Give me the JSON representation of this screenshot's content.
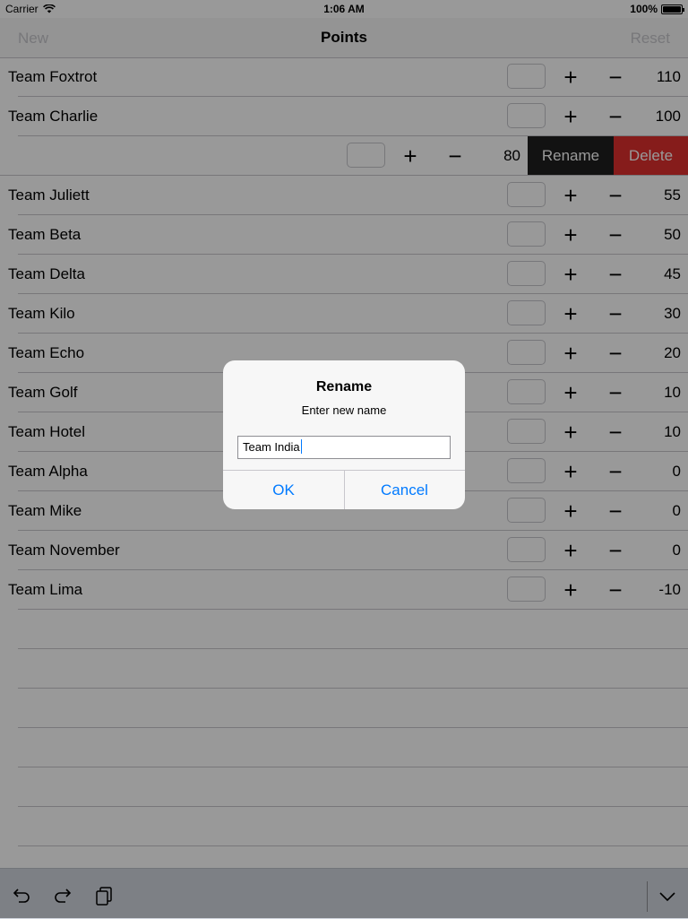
{
  "status_bar": {
    "carrier": "Carrier",
    "time": "1:06 AM",
    "battery": "100%"
  },
  "nav": {
    "left_button": "New",
    "title": "Points",
    "right_button": "Reset"
  },
  "teams": [
    {
      "name": "Team Foxtrot",
      "score": "110"
    },
    {
      "name": "Team Charlie",
      "score": "100"
    },
    {
      "name": "",
      "score": "80"
    },
    {
      "name": "Team Juliett",
      "score": "55"
    },
    {
      "name": "Team Beta",
      "score": "50"
    },
    {
      "name": "Team Delta",
      "score": "45"
    },
    {
      "name": "Team Kilo",
      "score": "30"
    },
    {
      "name": "Team Echo",
      "score": "20"
    },
    {
      "name": "Team Golf",
      "score": "10"
    },
    {
      "name": "Team Hotel",
      "score": "10"
    },
    {
      "name": "Team Alpha",
      "score": "0"
    },
    {
      "name": "Team Mike",
      "score": "0"
    },
    {
      "name": "Team November",
      "score": "0"
    },
    {
      "name": "Team Lima",
      "score": "-10"
    }
  ],
  "row_controls": {
    "plus": "+",
    "minus": "−"
  },
  "swipe_actions": {
    "rename": "Rename",
    "delete": "Delete"
  },
  "alert": {
    "title": "Rename",
    "message": "Enter new name",
    "input_value": "Team India",
    "ok": "OK",
    "cancel": "Cancel"
  },
  "colors": {
    "accent": "#007aff",
    "delete": "#e0302d",
    "rename": "#1e1e1e"
  },
  "icons": [
    "wifi-icon",
    "battery-icon",
    "undo-icon",
    "redo-icon",
    "paste-icon",
    "keyboard-dismiss-icon"
  ]
}
